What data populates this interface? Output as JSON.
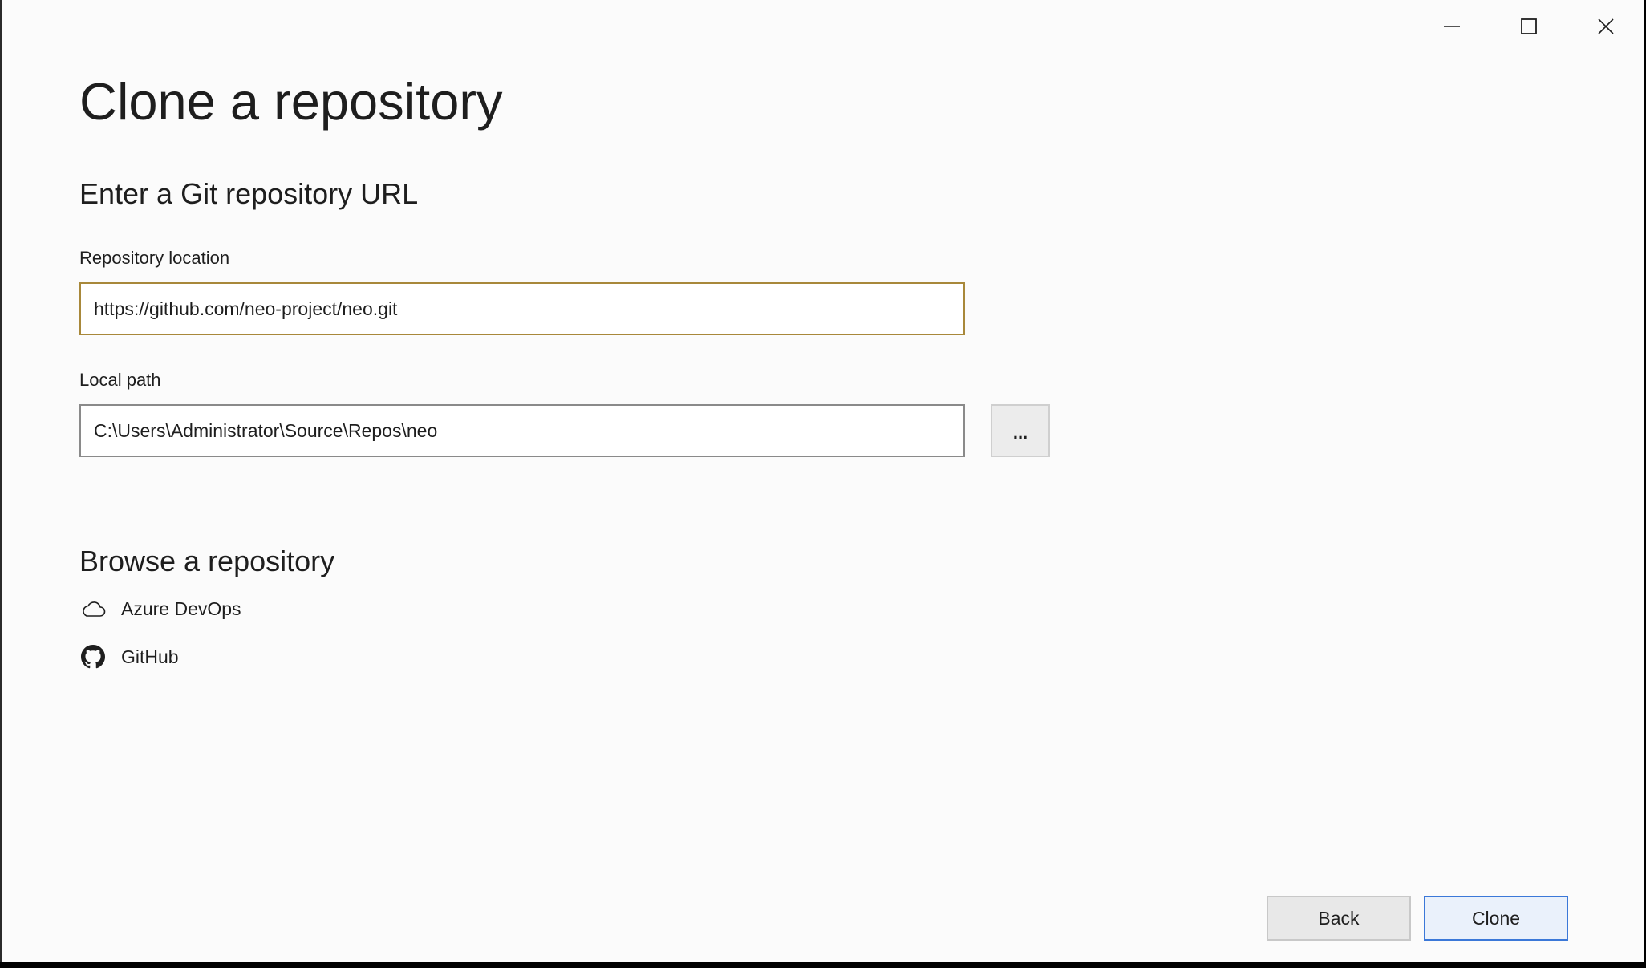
{
  "window": {
    "controls": {
      "minimize_icon": "minimize-icon",
      "maximize_icon": "maximize-icon",
      "close_icon": "close-icon"
    }
  },
  "page": {
    "title": "Clone a repository"
  },
  "url_section": {
    "heading": "Enter a Git repository URL",
    "repository_location": {
      "label": "Repository location",
      "value": "https://github.com/neo-project/neo.git"
    },
    "local_path": {
      "label": "Local path",
      "value": "C:\\Users\\Administrator\\Source\\Repos\\neo",
      "browse_label": "..."
    }
  },
  "browse_section": {
    "heading": "Browse a repository",
    "items": [
      {
        "label": "Azure DevOps",
        "icon": "cloud-icon"
      },
      {
        "label": "GitHub",
        "icon": "github-icon"
      }
    ]
  },
  "footer": {
    "back_label": "Back",
    "clone_label": "Clone"
  },
  "colors": {
    "background": "#fbfbfb",
    "focus_border": "#a8883a",
    "primary_border": "#3b78d8"
  }
}
